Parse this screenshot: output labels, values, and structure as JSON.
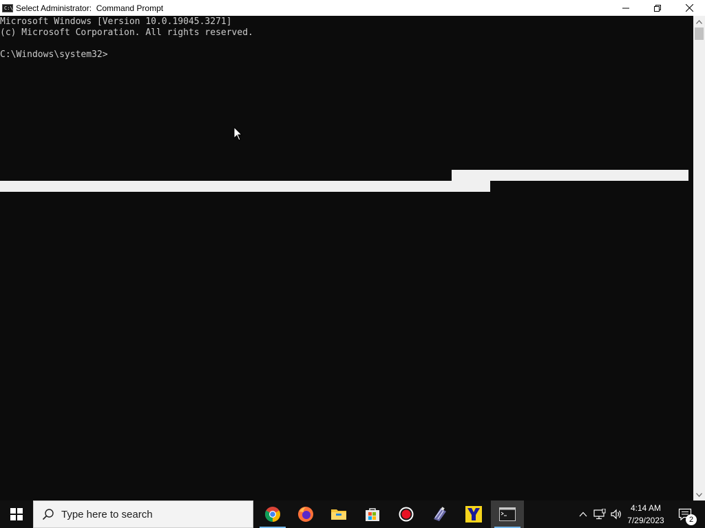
{
  "window": {
    "title": "Select Administrator:  Command Prompt",
    "app_icon_text": "C:\\"
  },
  "console": {
    "lines": [
      "Microsoft Windows [Version 10.0.19045.3271]",
      "(c) Microsoft Corporation. All rights reserved.",
      "",
      "C:\\Windows\\system32>"
    ]
  },
  "taskbar": {
    "search_placeholder": "Type here to search",
    "pinned_apps": [
      "chrome-icon",
      "firefox-icon",
      "file-explorer-icon",
      "microsoft-store-icon",
      "screen-recorder-icon",
      "video-editor-icon",
      "y-app-icon",
      "command-prompt-icon"
    ],
    "active_app": "command-prompt-icon"
  },
  "tray": {
    "time": "4:14 AM",
    "date": "7/29/2023",
    "notification_count": "2"
  },
  "colors": {
    "console_bg": "#0c0c0c",
    "console_text": "#cccccc",
    "titlebar_bg": "#ffffff",
    "taskbar_bg": "#101010",
    "accent": "#76b9ed"
  }
}
